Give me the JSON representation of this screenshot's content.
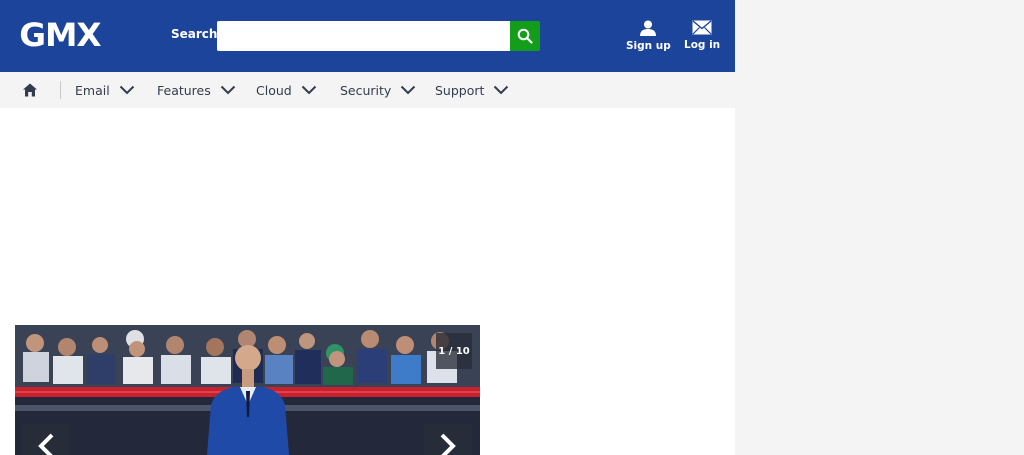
{
  "header": {
    "logo": "GMX",
    "search_label": "Search",
    "search_placeholder": "",
    "signup_label": "Sign up",
    "login_label": "Log in"
  },
  "nav": {
    "items": [
      {
        "label": "Email"
      },
      {
        "label": "Features"
      },
      {
        "label": "Cloud"
      },
      {
        "label": "Security"
      },
      {
        "label": "Support"
      }
    ]
  },
  "gallery": {
    "counter": "1 / 10"
  },
  "colors": {
    "brand_blue": "#1c449b",
    "search_green": "#149c1b",
    "nav_bg": "#f4f4f4",
    "nav_text": "#333c4e"
  },
  "icons": {
    "search": "search-icon",
    "signup": "user-icon",
    "login": "mail-icon",
    "home": "home-icon",
    "dropdown": "chevron-down-icon",
    "prev": "chevron-left-icon",
    "next": "chevron-right-icon"
  }
}
